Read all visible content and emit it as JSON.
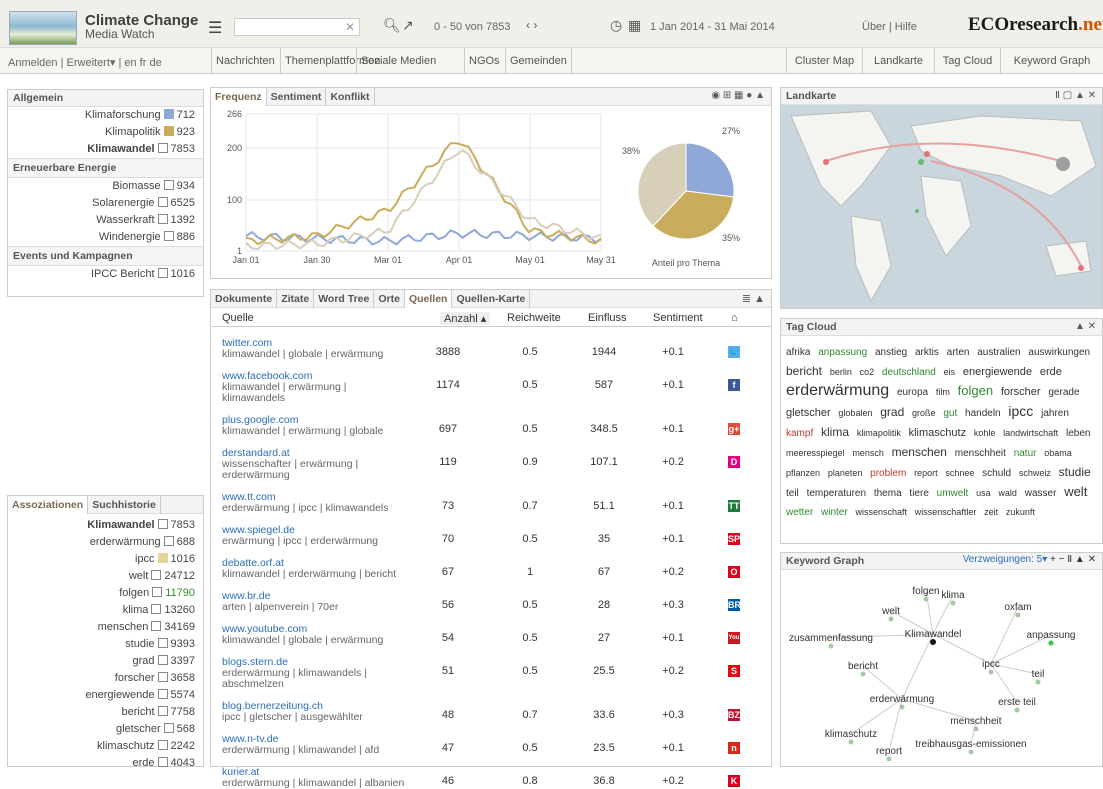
{
  "header": {
    "brand": "Climate Change",
    "brand_sub": "Media Watch",
    "range": "0 - 50 von 7853",
    "date": "1 Jan 2014 - 31 Mai 2014",
    "links": "Über | Hilfe",
    "logo": "ECOresearch.net"
  },
  "nav": {
    "left": "Anmelden | Erweitert▾ | en fr de",
    "tabs": [
      "Nachrichten",
      "Themenplattformen",
      "Soziale Medien",
      "NGOs",
      "Gemeinden"
    ],
    "right_tabs": [
      "Cluster Map",
      "Landkarte",
      "Tag Cloud",
      "Keyword Graph"
    ]
  },
  "left": {
    "title": "Allgemein",
    "general": [
      {
        "label": "Klimaforschung",
        "count": "712",
        "color": "#8fa8d8"
      },
      {
        "label": "Klimapolitik",
        "count": "923",
        "color": "#c9ac5c"
      },
      {
        "label": "Klimawandel",
        "count": "7853",
        "color": ""
      }
    ],
    "ee_title": "Erneuerbare Energie",
    "ee": [
      {
        "label": "Biomasse",
        "count": "934"
      },
      {
        "label": "Solarenergie",
        "count": "6525"
      },
      {
        "label": "Wasserkraft",
        "count": "1392"
      },
      {
        "label": "Windenergie",
        "count": "886"
      }
    ],
    "ev_title": "Events und Kampagnen",
    "ev": [
      {
        "label": "IPCC Bericht",
        "count": "1016"
      }
    ],
    "assoc_tabs": [
      "Assoziationen",
      "Suchhistorie"
    ],
    "assoc": [
      {
        "label": "Klimawandel",
        "count": "7853"
      },
      {
        "label": "erderwärmung",
        "count": "688"
      },
      {
        "label": "ipcc",
        "count": "1016"
      },
      {
        "label": "welt",
        "count": "24712"
      },
      {
        "label": "folgen",
        "count": "11790"
      },
      {
        "label": "klima",
        "count": "13260"
      },
      {
        "label": "menschen",
        "count": "34169"
      },
      {
        "label": "studie",
        "count": "9393"
      },
      {
        "label": "grad",
        "count": "3397"
      },
      {
        "label": "forscher",
        "count": "3658"
      },
      {
        "label": "energiewende",
        "count": "5574"
      },
      {
        "label": "bericht",
        "count": "7758"
      },
      {
        "label": "gletscher",
        "count": "568"
      },
      {
        "label": "klimaschutz",
        "count": "2242"
      },
      {
        "label": "erde",
        "count": "4043"
      }
    ]
  },
  "chart": {
    "tabs": [
      "Frequenz",
      "Sentiment",
      "Konflikt"
    ],
    "y_ticks": [
      "266",
      "200",
      "100",
      "1"
    ],
    "x_ticks": [
      "Jan 01",
      "Jan 30",
      "Mar 01",
      "Apr 01",
      "May 01",
      "May 31"
    ],
    "pie_title": "Anteil pro Thema",
    "pie_labels": [
      "27%",
      "35%",
      "38%"
    ]
  },
  "chart_data": {
    "type": "line",
    "title": "",
    "x": [
      "Jan 01",
      "Jan 30",
      "Mar 01",
      "Apr 01",
      "May 01",
      "May 31"
    ],
    "ylim": [
      1,
      266
    ],
    "series": [
      {
        "name": "Klimaforschung",
        "color": "#8fa8d8",
        "values": [
          30,
          25,
          20,
          35,
          30,
          25
        ]
      },
      {
        "name": "Klimapolitik",
        "color": "#c9ac5c",
        "values": [
          20,
          30,
          80,
          220,
          40,
          20
        ]
      },
      {
        "name": "Klimawandel",
        "color": "#d8cfb8",
        "values": [
          10,
          15,
          40,
          200,
          60,
          25
        ]
      }
    ],
    "pie": {
      "labels": [
        "Klimaforschung",
        "Klimapolitik",
        "Klimawandel"
      ],
      "values": [
        27,
        35,
        38
      ],
      "colors": [
        "#8fa8d8",
        "#c9ac5c",
        "#d8cfb8"
      ]
    }
  },
  "docs": {
    "tabs": [
      "Dokumente",
      "Zitate",
      "Word Tree",
      "Orte",
      "Quellen",
      "Quellen-Karte"
    ],
    "cols": [
      "Quelle",
      "Anzahl ▴",
      "Reichweite",
      "Einfluss",
      "Sentiment"
    ],
    "rows": [
      {
        "src": "twitter.com",
        "kw": "klimawandel | globale | erwärmung",
        "n": "3888",
        "r": "0.5",
        "e": "1944",
        "s": "+0.1",
        "ic": "#55acee",
        "ch": "🐦"
      },
      {
        "src": "www.facebook.com",
        "kw": "klimawandel | erwärmung | klimawandels",
        "n": "1174",
        "r": "0.5",
        "e": "587",
        "s": "+0.1",
        "ic": "#3b5998",
        "ch": "f"
      },
      {
        "src": "plus.google.com",
        "kw": "klimawandel | erwärmung | globale",
        "n": "697",
        "r": "0.5",
        "e": "348.5",
        "s": "+0.1",
        "ic": "#dd4b39",
        "ch": "g+"
      },
      {
        "src": "derstandard.at",
        "kw": "wissenschafter | erwärmung | erderwärmung",
        "n": "119",
        "r": "0.9",
        "e": "107.1",
        "s": "+0.2",
        "ic": "#e6007e",
        "ch": "D"
      },
      {
        "src": "www.tt.com",
        "kw": "erderwärmung | ipcc | klimawandels",
        "n": "73",
        "r": "0.7",
        "e": "51.1",
        "s": "+0.1",
        "ic": "#1e7b3c",
        "ch": "TT"
      },
      {
        "src": "www.spiegel.de",
        "kw": "erwärmung | ipcc | erderwärmung",
        "n": "70",
        "r": "0.5",
        "e": "35",
        "s": "+0.1",
        "ic": "#e2001a",
        "ch": "SP"
      },
      {
        "src": "debatte.orf.at",
        "kw": "klimawandel | erderwärmung | bericht",
        "n": "67",
        "r": "1",
        "e": "67",
        "s": "+0.2",
        "ic": "#d9041f",
        "ch": "O"
      },
      {
        "src": "www.br.de",
        "kw": "arten | alpenverein | 70er",
        "n": "56",
        "r": "0.5",
        "e": "28",
        "s": "+0.3",
        "ic": "#005ca9",
        "ch": "BR"
      },
      {
        "src": "www.youtube.com",
        "kw": "klimawandel | globale | erwärmung",
        "n": "54",
        "r": "0.5",
        "e": "27",
        "s": "+0.1",
        "ic": "#cc181e",
        "ch": "You"
      },
      {
        "src": "blogs.stern.de",
        "kw": "erderwärmung | klimawandels | abschmelzen",
        "n": "51",
        "r": "0.5",
        "e": "25.5",
        "s": "+0.2",
        "ic": "#e30613",
        "ch": "S"
      },
      {
        "src": "blog.bernerzeitung.ch",
        "kw": "ipcc | gletscher | ausgewählter",
        "n": "48",
        "r": "0.7",
        "e": "33.6",
        "s": "+0.3",
        "ic": "#c8102e",
        "ch": "BZ"
      },
      {
        "src": "www.n-tv.de",
        "kw": "erderwärmung | klimawandel | afd",
        "n": "47",
        "r": "0.5",
        "e": "23.5",
        "s": "+0.1",
        "ic": "#d52b1e",
        "ch": "n"
      },
      {
        "src": "kurier.at",
        "kw": "erderwärmung | klimawandel | albanien",
        "n": "46",
        "r": "0.8",
        "e": "36.8",
        "s": "+0.2",
        "ic": "#d8001f",
        "ch": "K"
      }
    ]
  },
  "map": {
    "title": "Landkarte"
  },
  "tagcloud": {
    "title": "Tag Cloud",
    "tags": [
      [
        "afrika",
        10,
        "#333"
      ],
      [
        "anpassung",
        10,
        "#2e8b2e"
      ],
      [
        "anstieg",
        10,
        "#333"
      ],
      [
        "arktis",
        10,
        "#333"
      ],
      [
        "arten",
        10,
        "#333"
      ],
      [
        "australien",
        10,
        "#333"
      ],
      [
        "auswirkungen",
        10,
        "#333"
      ],
      [
        "bericht",
        12,
        "#333"
      ],
      [
        "berlin",
        9,
        "#333"
      ],
      [
        "co2",
        9,
        "#333"
      ],
      [
        "deutschland",
        10,
        "#2e8b2e"
      ],
      [
        "eis",
        9,
        "#333"
      ],
      [
        "energiewende",
        11,
        "#333"
      ],
      [
        "erde",
        11,
        "#333"
      ],
      [
        "erderwärmung",
        16,
        "#333"
      ],
      [
        "europa",
        10,
        "#333"
      ],
      [
        "film",
        9,
        "#333"
      ],
      [
        "folgen",
        13,
        "#2e8b2e"
      ],
      [
        "forscher",
        11,
        "#333"
      ],
      [
        "gerade",
        10,
        "#333"
      ],
      [
        "gletscher",
        11,
        "#333"
      ],
      [
        "globalen",
        9,
        "#333"
      ],
      [
        "grad",
        12,
        "#333"
      ],
      [
        "große",
        9,
        "#333"
      ],
      [
        "gut",
        10,
        "#2e8b2e"
      ],
      [
        "handeln",
        10,
        "#333"
      ],
      [
        "ipcc",
        14,
        "#333"
      ],
      [
        "jahren",
        10,
        "#333"
      ],
      [
        "kampf",
        10,
        "#c0392b"
      ],
      [
        "klima",
        12,
        "#333"
      ],
      [
        "klimapolitik",
        9,
        "#333"
      ],
      [
        "klimaschutz",
        11,
        "#333"
      ],
      [
        "kohle",
        9,
        "#333"
      ],
      [
        "landwirtschaft",
        9,
        "#333"
      ],
      [
        "leben",
        10,
        "#333"
      ],
      [
        "meeresspiegel",
        9,
        "#333"
      ],
      [
        "mensch",
        9,
        "#333"
      ],
      [
        "menschen",
        12,
        "#333"
      ],
      [
        "menschheit",
        10,
        "#333"
      ],
      [
        "natur",
        10,
        "#2e8b2e"
      ],
      [
        "obama",
        9,
        "#333"
      ],
      [
        "pflanzen",
        9,
        "#333"
      ],
      [
        "planeten",
        9,
        "#333"
      ],
      [
        "problem",
        10,
        "#c0392b"
      ],
      [
        "report",
        9,
        "#333"
      ],
      [
        "schnee",
        9,
        "#333"
      ],
      [
        "schuld",
        10,
        "#333"
      ],
      [
        "schweiz",
        9,
        "#333"
      ],
      [
        "studie",
        12,
        "#333"
      ],
      [
        "teil",
        10,
        "#333"
      ],
      [
        "temperaturen",
        10,
        "#333"
      ],
      [
        "thema",
        10,
        "#333"
      ],
      [
        "tiere",
        10,
        "#333"
      ],
      [
        "umwelt",
        10,
        "#2e8b2e"
      ],
      [
        "usa",
        9,
        "#333"
      ],
      [
        "wald",
        9,
        "#333"
      ],
      [
        "wasser",
        10,
        "#333"
      ],
      [
        "welt",
        13,
        "#333"
      ],
      [
        "wetter",
        10,
        "#2e8b2e"
      ],
      [
        "winter",
        10,
        "#2e8b2e"
      ],
      [
        "wissenschaft",
        9,
        "#333"
      ],
      [
        "wissenschaftler",
        9,
        "#333"
      ],
      [
        "zeit",
        9,
        "#333"
      ],
      [
        "zukunft",
        9,
        "#333"
      ]
    ]
  },
  "kgraph": {
    "title": "Keyword Graph",
    "branch": "Verzweigungen: 5▾",
    "nodes": [
      "folgen",
      "klima",
      "welt",
      "oxfam",
      "zusammenfassung",
      "Klimawandel",
      "anpassung",
      "bericht",
      "ipcc",
      "teil",
      "erste teil",
      "erderwärmung",
      "menschheit",
      "klimaschutz",
      "report",
      "treibhausgas-emissionen"
    ]
  }
}
